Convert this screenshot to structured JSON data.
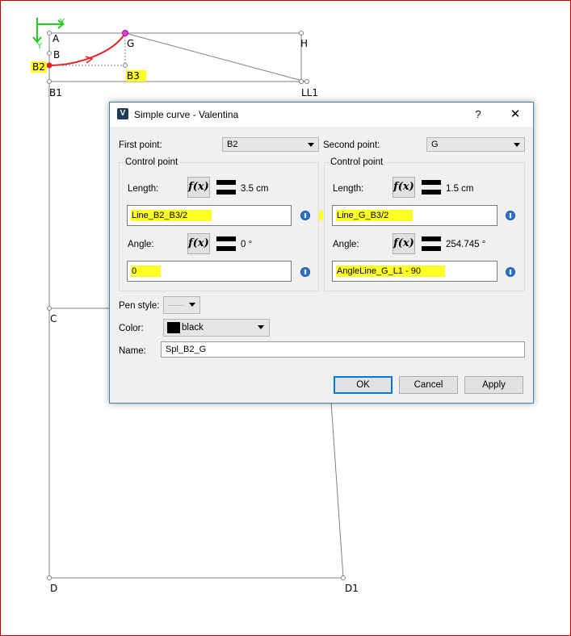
{
  "drawing": {
    "axis_x": "X",
    "axis_y": "Y",
    "points": {
      "A": "A",
      "B": "B",
      "B2": "B2",
      "G": "G",
      "H": "H",
      "B3": "B3",
      "B1": "B1",
      "LL1": "LL1",
      "C": "C",
      "D": "D",
      "D1": "D1"
    }
  },
  "dialog": {
    "title": "Simple curve - Valentina",
    "help": "?",
    "close": "✕",
    "first_point_label": "First point:",
    "first_point_value": "B2",
    "second_point_label": "Second point:",
    "second_point_value": "G",
    "left_group": {
      "title": "Control point",
      "length_label": "Length:",
      "length_value": "3.5 cm",
      "length_formula": "Line_B2_B3/2",
      "angle_label": "Angle:",
      "angle_value": "0 °",
      "angle_formula": "0"
    },
    "right_group": {
      "title": "Control point",
      "length_label": "Length:",
      "length_value": "1.5 cm",
      "length_formula": "Line_G_B3/2",
      "angle_label": "Angle:",
      "angle_value": "254.745 °",
      "angle_formula": "AngleLine_G_L1 - 90"
    },
    "fx_label": "f(x)",
    "pen_style_label": "Pen style:",
    "color_label": "Color:",
    "color_value": "black",
    "name_label": "Name:",
    "name_value": "Spl_B2_G",
    "ok": "OK",
    "cancel": "Cancel",
    "apply": "Apply"
  },
  "colors": {
    "highlight": "#ffff22",
    "curve": "#e0201e",
    "axis": "#22cc22",
    "border": "#c00000",
    "accent": "#0078d7"
  }
}
